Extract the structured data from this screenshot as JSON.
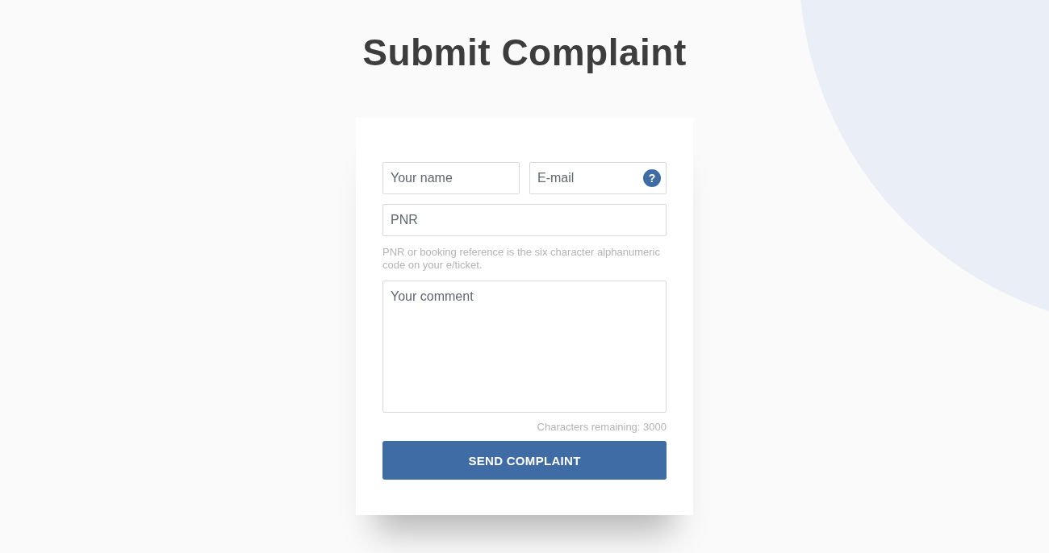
{
  "title": "Submit Complaint",
  "form": {
    "name_field": {
      "placeholder": "Your name"
    },
    "email_field": {
      "placeholder": "E-mail",
      "help_icon": "?"
    },
    "pnr_field": {
      "placeholder": "PNR"
    },
    "pnr_hint": "PNR or booking reference is the six character alphanumeric code on your e/ticket.",
    "comment_field": {
      "placeholder": "Your comment"
    },
    "counter": "Characters remaining: 3000",
    "submit_button": "SEND COMPLAINT"
  }
}
